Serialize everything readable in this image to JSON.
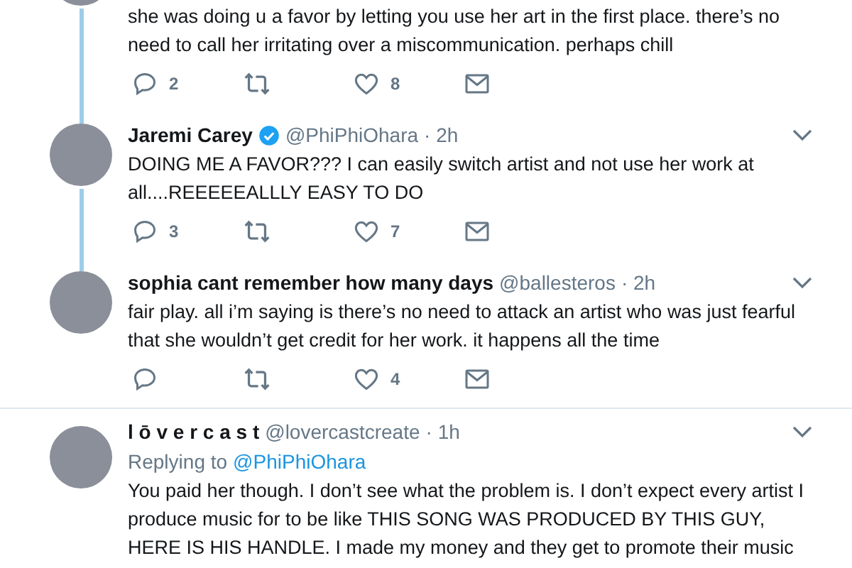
{
  "tweets": [
    {
      "text": "she was doing u a favor by letting you use her art in the first place. there’s no need to call her irritating over a miscommunication. perhaps chill",
      "actions": {
        "replies": "2",
        "likes": "8"
      },
      "thread_connector": true
    },
    {
      "name": "Jaremi Carey",
      "verified": true,
      "handle": "@PhiPhiOhara",
      "time": "· 2h",
      "text": "DOING ME A FAVOR??? I can easily switch artist and not use her work at all....REEEEEALLLY EASY TO DO",
      "actions": {
        "replies": "3",
        "likes": "7"
      },
      "thread_connector": true
    },
    {
      "name": "sophia cant remember how many days",
      "verified": false,
      "handle": "@ballesteros",
      "time": "· 2h",
      "text": "fair play. all i’m saying is there’s no need to attack an artist who was just fearful that she wouldn’t get credit for her work. it happens all the time",
      "actions": {
        "likes": "4"
      },
      "thread_connector": false
    },
    {
      "name": "l ō v e r c a s t",
      "verified": false,
      "handle": "@lovercastcreate",
      "time": "· 1h",
      "replying_label": "Replying to",
      "replying_to": "@PhiPhiOhara",
      "text": "You paid her though. I don’t see what the problem is. I don’t expect every artist I produce music for to be like THIS SONG WAS PRODUCED BY THIS GUY, HERE IS HIS HANDLE. I made my money and they get to promote their music",
      "thread_connector": false
    }
  ]
}
